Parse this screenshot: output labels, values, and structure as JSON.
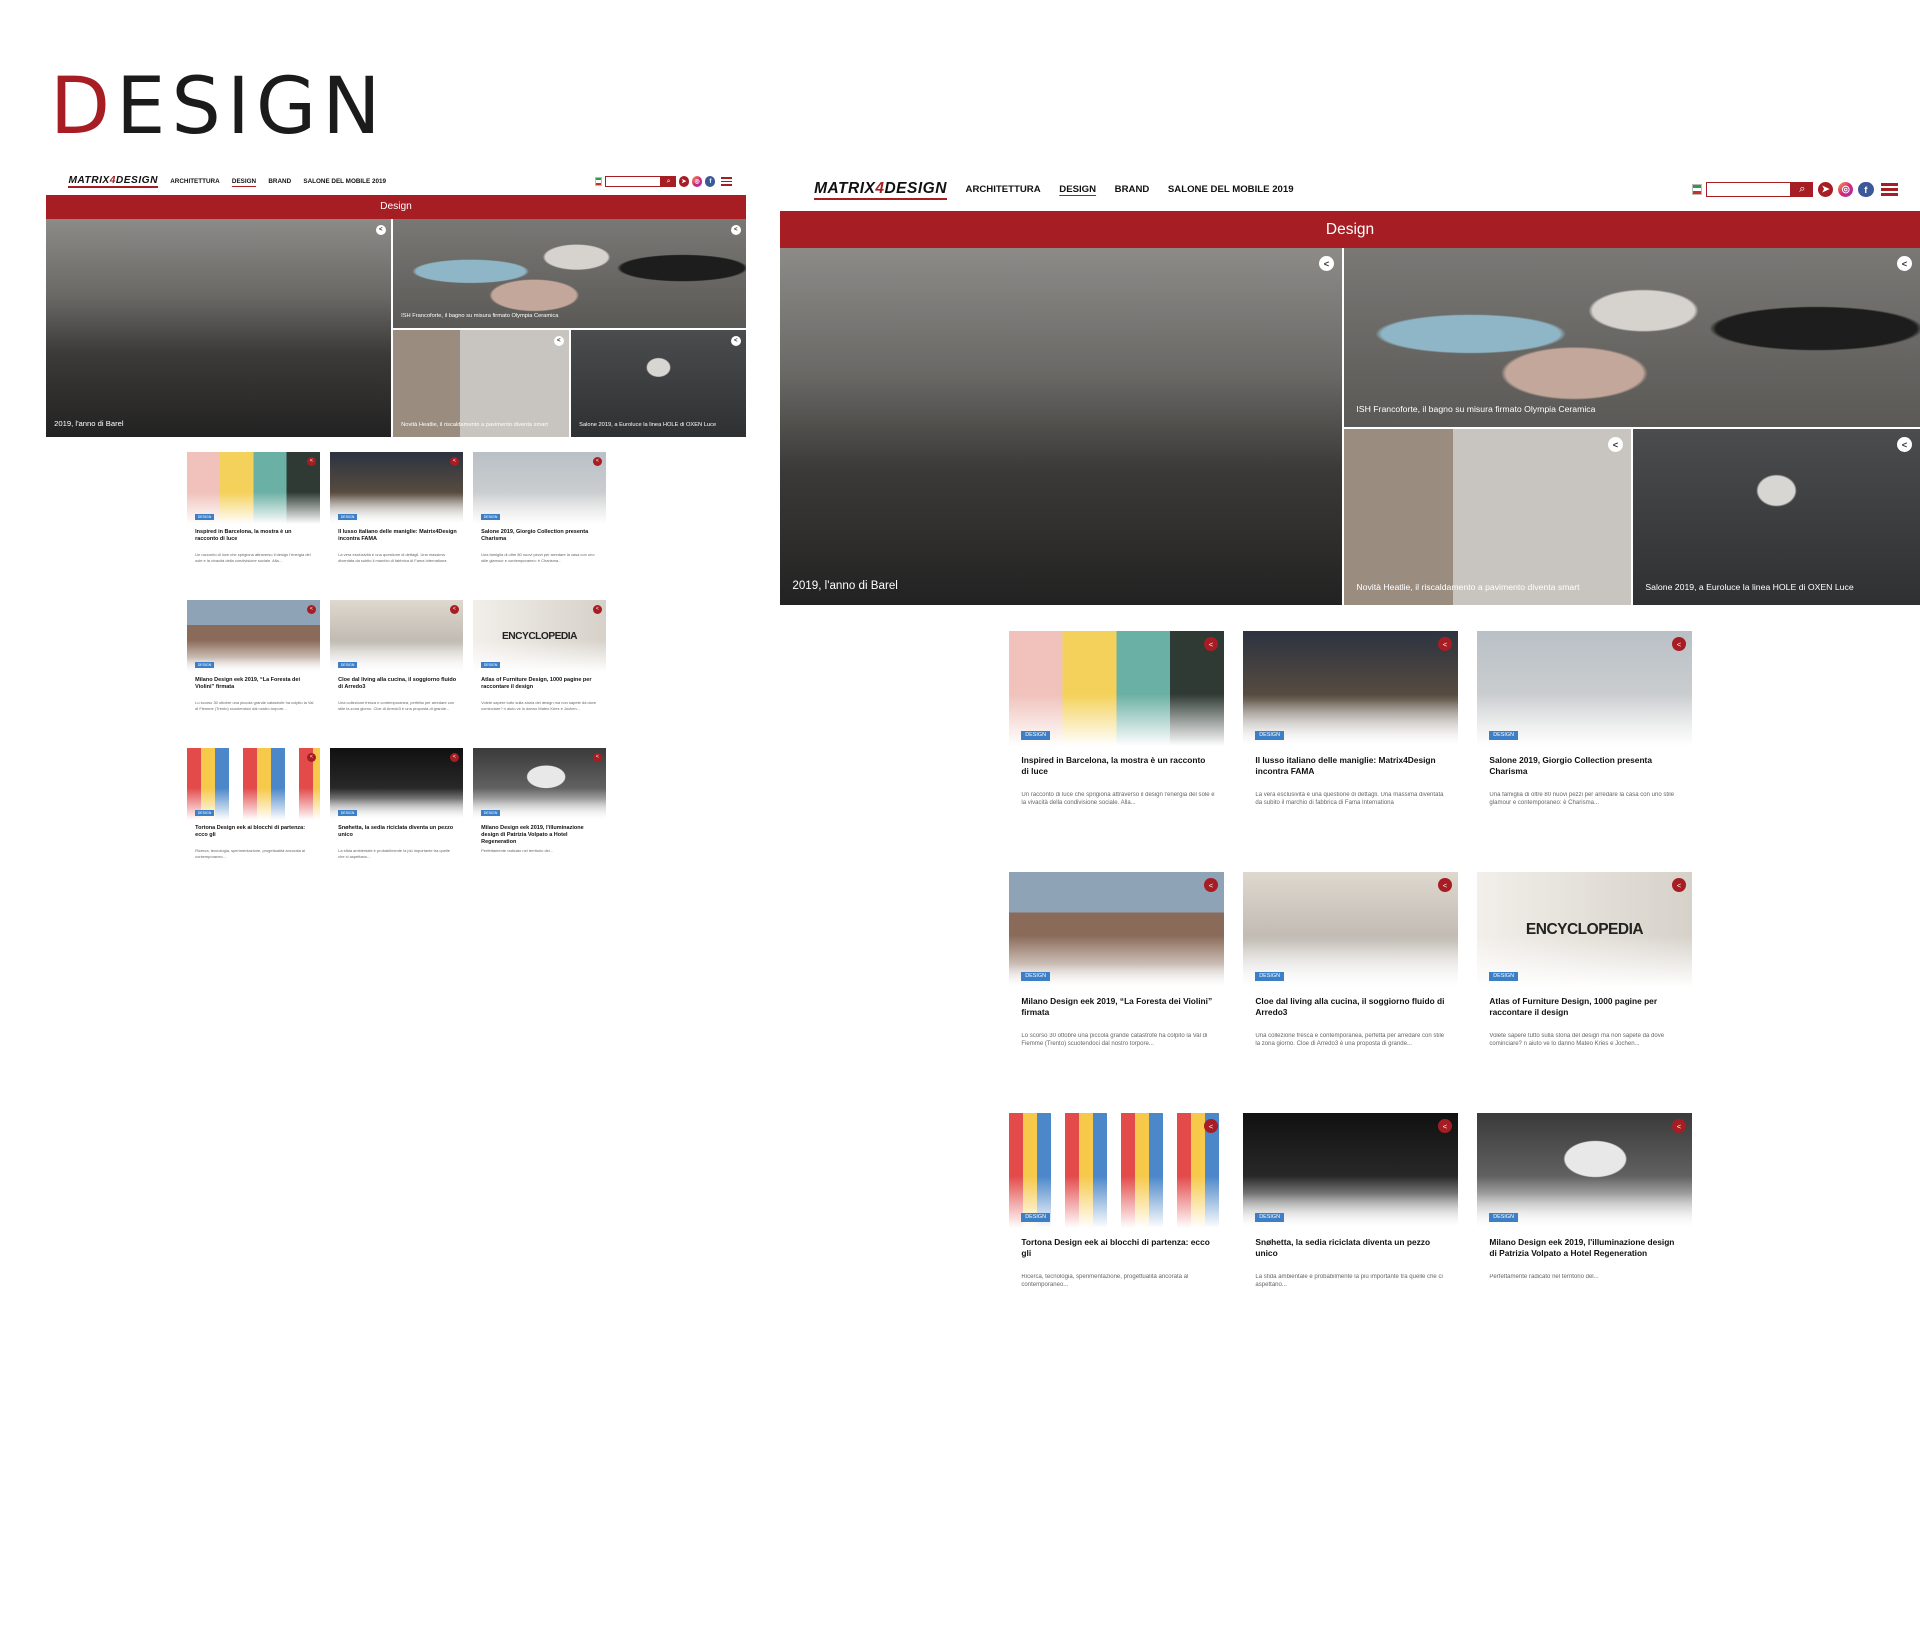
{
  "heading": {
    "first_letter": "D",
    "rest": "ESIGN"
  },
  "site": {
    "logo_pre": "MATRIX",
    "logo_num": "4",
    "logo_post": "DESIGN",
    "nav": [
      "ARCHITETTURA",
      "DESIGN",
      "BRAND",
      "SALONE DEL MOBILE 2019"
    ],
    "search_placeholder": "",
    "search_icon": "search-icon",
    "social_icons": [
      "telegram-icon",
      "instagram-icon",
      "facebook-icon"
    ],
    "menu_icon": "menu-icon"
  },
  "band_title": "Design",
  "heroes": [
    {
      "caption": "2019, l'anno di Barel"
    },
    {
      "caption": "ISH Francoforte, il bagno su misura firmato Olympia Ceramica"
    },
    {
      "caption": "Novità Heatlie, il riscaldamento a pavimento diventa smart"
    },
    {
      "caption": "Salone 2019, a Euroluce la linea HOLE di OXEN Luce"
    }
  ],
  "badge": "DESIGN",
  "cards": [
    {
      "title": "Inspired in Barcelona, la mostra è un racconto di luce",
      "excerpt": "Un racconto di luce che sprigiona attraverso il design l'energia del sole e la vivacità della condivisione sociale. Alla..."
    },
    {
      "title": "Il lusso italiano delle maniglie: Matrix4Design incontra FAMA",
      "excerpt": "La vera esclusività è una questione di dettagli. Una massima diventata da subito il marchio di fabbrica di Fama Internationa"
    },
    {
      "title": "Salone 2019, Giorgio Collection presenta Charisma",
      "excerpt": "Una famiglia di oltre 80 nuovi pezzi per arredare la casa con uno stile glamour e contemporaneo: è Charisma..."
    },
    {
      "title": "Milano Design    eek 2019, “La Foresta dei Violini” firmata",
      "excerpt": "Lo scorso 30 ottobre una piccola grande catastrofe ha colpito la Val di Fiemme (Trento) scuotendoci dal nostro torpore..."
    },
    {
      "title": "Cloe dal living alla cucina, il soggiorno fluido di Arredo3",
      "excerpt": "Una collezione fresca e contemporanea, perfetta per arredare con stile la zona giorno. Cloe di Arredo3 è una proposta di grande..."
    },
    {
      "title": "Atlas of Furniture Design, 1000 pagine per raccontare il design",
      "excerpt": "Volete sapere tutto sulla storia del design ma non sapete da dove cominciare? n aiuto ve lo danno Mateo Kries e Jochen..."
    },
    {
      "title": "Tortona Design    eek ai blocchi di partenza: ecco gli",
      "excerpt": "Ricerca, tecnologia, sperimentazione, progettualità ancorata al contemporaneo..."
    },
    {
      "title": "Snøhetta, la sedia riciclata diventa un pezzo unico",
      "excerpt": "La sfida ambientale è probabilmente la più importante tra quelle che ci aspettano..."
    },
    {
      "title": "Milano Design    eek 2019, l'illuminazione design di Patrizia Volpato a Hotel Regeneration",
      "excerpt": "Perfettamente radicato nel territorio del..."
    }
  ],
  "card_overlay_text": {
    "encyclopedia": "ENCYCLOPEDIA"
  }
}
